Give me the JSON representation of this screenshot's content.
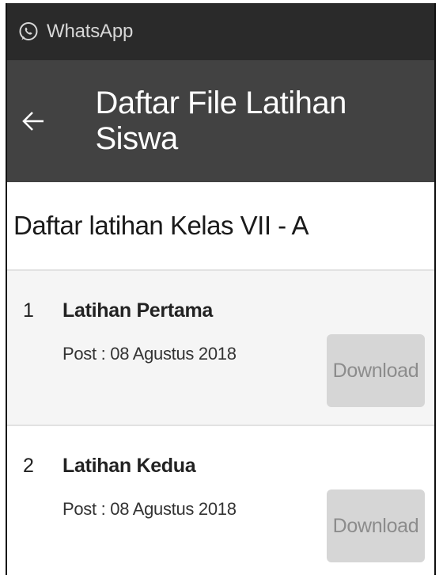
{
  "status_bar": {
    "app_name": "WhatsApp",
    "icon": "whatsapp-icon"
  },
  "app_bar": {
    "back_icon": "arrow-back-icon",
    "title": "Daftar File Latihan Siswa"
  },
  "section": {
    "title": "Daftar latihan Kelas VII - A"
  },
  "items": [
    {
      "number": "1",
      "name": "Latihan Pertama",
      "date": "Post : 08 Agustus 2018",
      "button_label": "Download"
    },
    {
      "number": "2",
      "name": "Latihan Kedua",
      "date": "Post : 08 Agustus 2018",
      "button_label": "Download"
    }
  ],
  "colors": {
    "status_bar_bg": "#2a2a2a",
    "app_bar_bg": "#424242",
    "row_alt_bg": "#f5f5f5",
    "button_bg": "#d6d6d6",
    "button_text": "#8c8c8c"
  }
}
